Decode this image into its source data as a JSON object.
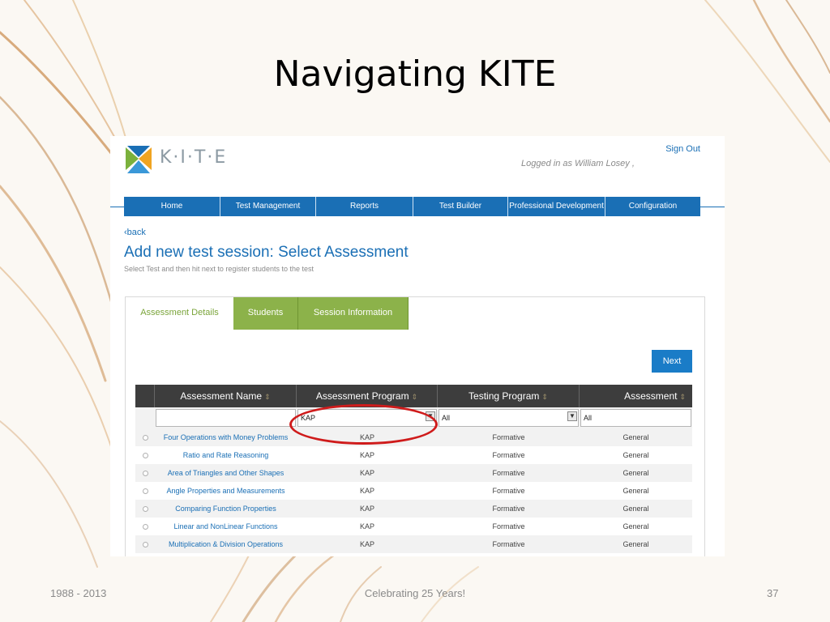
{
  "slide": {
    "title": "Navigating KITE",
    "footer_left": "1988 - 2013",
    "footer_center": "Celebrating 25 Years!",
    "footer_right": "37"
  },
  "app": {
    "logo_text": "K·I·T·E",
    "sign_out": "Sign Out",
    "logged_in": "Logged in as William Losey ,",
    "nav": [
      {
        "label": "Home"
      },
      {
        "label": "Test Management"
      },
      {
        "label": "Reports"
      },
      {
        "label": "Test Builder"
      },
      {
        "label": "Professional Development"
      },
      {
        "label": "Configuration"
      }
    ],
    "back": "‹back",
    "page_title": "Add new test session: Select Assessment",
    "page_subtitle": "Select Test and then hit next to register students to the test",
    "tabs": [
      {
        "label": "Assessment Details"
      },
      {
        "label": "Students"
      },
      {
        "label": "Session Information"
      }
    ],
    "next_label": "Next",
    "columns": [
      {
        "label": "Assessment Name",
        "sort": "⇕"
      },
      {
        "label": "Assessment Program",
        "sort": "⇕"
      },
      {
        "label": "Testing Program",
        "sort": "⇕"
      },
      {
        "label": "Assessment",
        "sort": "⇕"
      }
    ],
    "filters": {
      "name": "",
      "program": "KAP",
      "testing": "All",
      "assessment": "All"
    },
    "rows": [
      {
        "name": "Four Operations with Money Problems",
        "program": "KAP",
        "testing": "Formative",
        "assessment": "General"
      },
      {
        "name": "Ratio and Rate Reasoning",
        "program": "KAP",
        "testing": "Formative",
        "assessment": "General"
      },
      {
        "name": "Area of Triangles and Other Shapes",
        "program": "KAP",
        "testing": "Formative",
        "assessment": "General"
      },
      {
        "name": "Angle Properties and Measurements",
        "program": "KAP",
        "testing": "Formative",
        "assessment": "General"
      },
      {
        "name": "Comparing Function Properties",
        "program": "KAP",
        "testing": "Formative",
        "assessment": "General"
      },
      {
        "name": "Linear and NonLinear Functions",
        "program": "KAP",
        "testing": "Formative",
        "assessment": "General"
      },
      {
        "name": "Multiplication & Division Operations",
        "program": "KAP",
        "testing": "Formative",
        "assessment": "General"
      }
    ],
    "colors": {
      "nav_blue": "#1a6fb5",
      "tab_green": "#8cb24a",
      "highlight_red": "#cf1b1b"
    }
  }
}
